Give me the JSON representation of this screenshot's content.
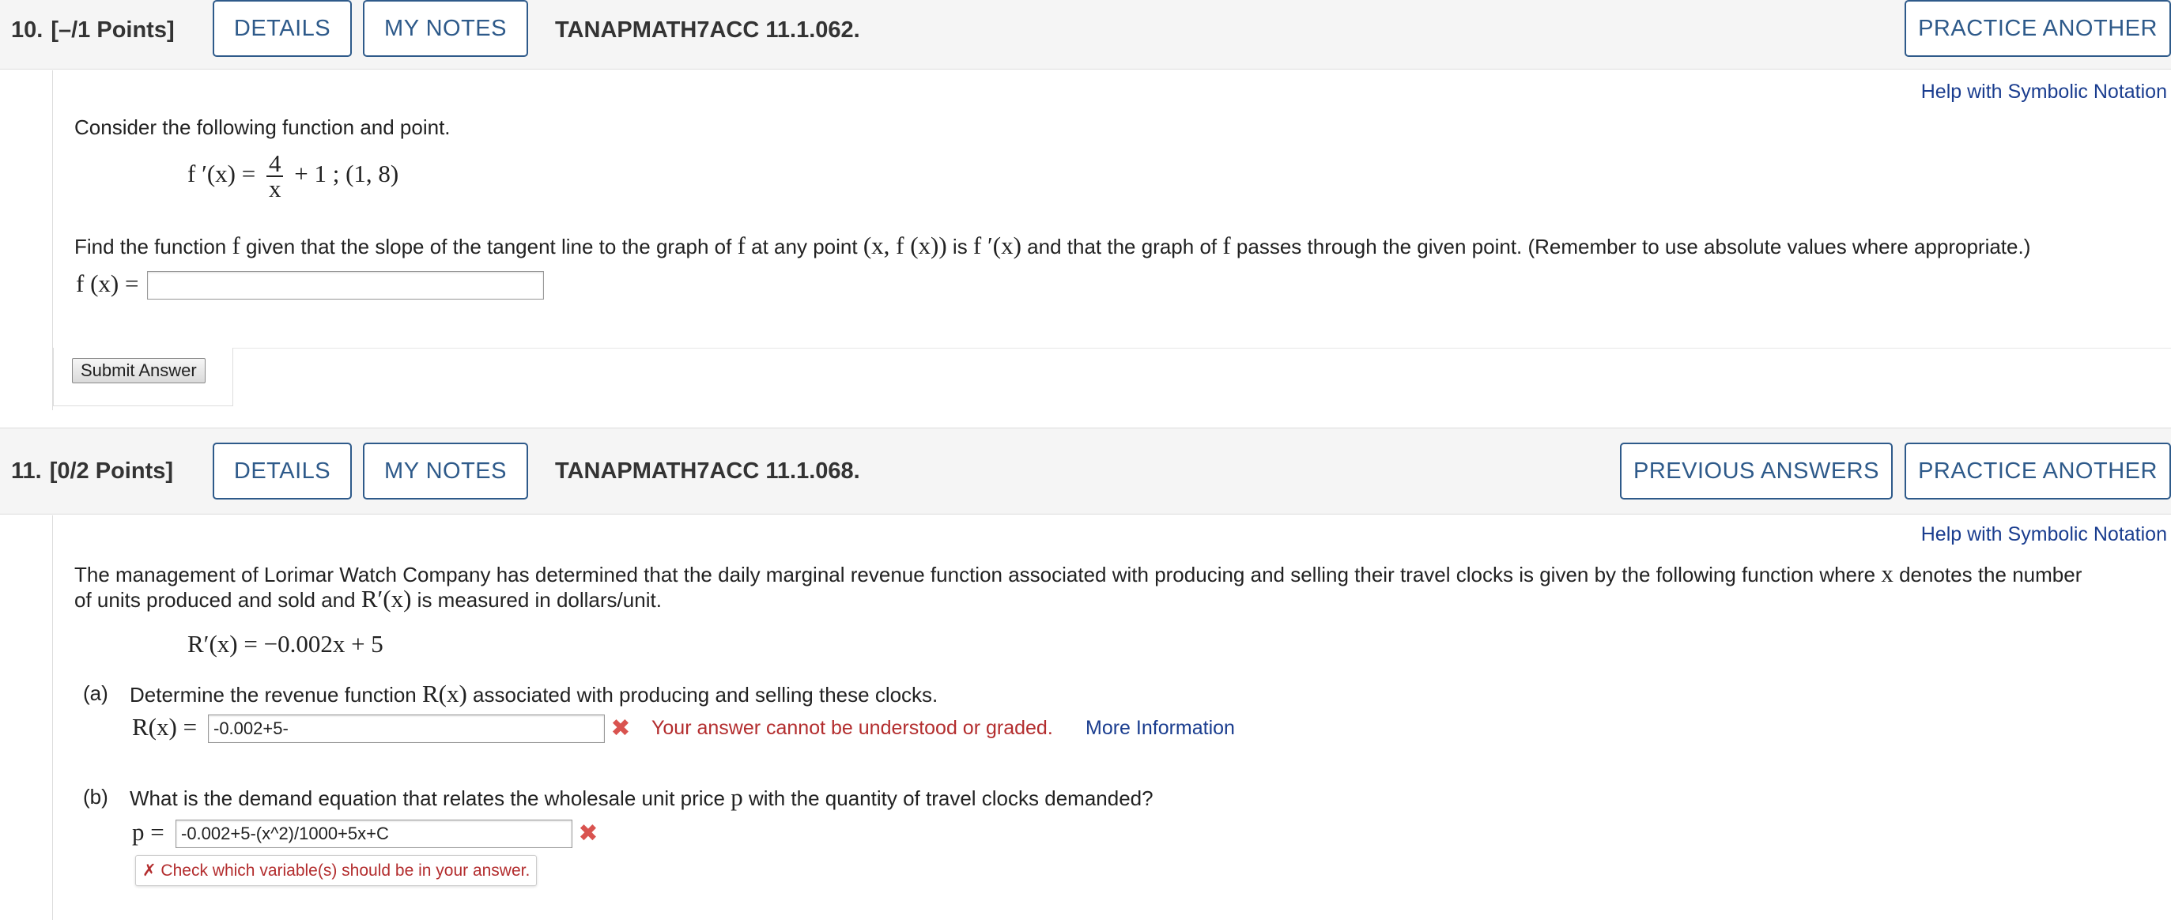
{
  "q10": {
    "number": "10.",
    "points": "[–/1 Points]",
    "details_label": "DETAILS",
    "notes_label": "MY NOTES",
    "code": "TANAPMATH7ACC 11.1.062.",
    "practice_label": "PRACTICE ANOTHER",
    "help_link": "Help with Symbolic Notation",
    "intro": "Consider the following function and point.",
    "formula": {
      "lhs": "f ′(x) =",
      "numerator": "4",
      "denominator": "x",
      "rest": "+ 1 ;  (1, 8)"
    },
    "prompt": {
      "p1": "Find the function ",
      "f1": "f",
      "p2": " given that the slope of the tangent line to the graph of ",
      "f2": "f",
      "p3": " at any point ",
      "pt": "(x, f (x))",
      "p4": " is ",
      "fp": "f ′(x)",
      "p5": " and that the graph of ",
      "f3": "f",
      "p6": " passes through the given point. (Remember to use absolute values where appropriate.)"
    },
    "answer_label": "f (x) =",
    "answer_value": "",
    "submit_label": "Submit Answer"
  },
  "q11": {
    "number": "11.",
    "points": "[0/2 Points]",
    "details_label": "DETAILS",
    "notes_label": "MY NOTES",
    "code": "TANAPMATH7ACC 11.1.068.",
    "previous_label": "PREVIOUS ANSWERS",
    "practice_label": "PRACTICE ANOTHER",
    "help_link": "Help with Symbolic Notation",
    "intro": {
      "line1_a": "The management of Lorimar Watch Company has determined that the daily marginal revenue function associated with producing and selling their travel clocks is given by the following function where ",
      "x": "x",
      "line1_b": " denotes the number",
      "line2_a": "of units produced and sold and ",
      "rp": "R′(x)",
      "line2_b": " is measured in dollars/unit."
    },
    "formula": "R′(x) = −0.002x + 5",
    "part_a": {
      "label": "(a)",
      "q1": "Determine the revenue function ",
      "rx": "R(x)",
      "q2": " associated with producing and selling these clocks.",
      "answer_label": "R(x) =",
      "answer_value": "-0.002+5-",
      "error": "Your answer cannot be understood or graded.",
      "more_info": "More Information"
    },
    "part_b": {
      "label": "(b)",
      "q1": "What is the demand equation that relates the wholesale unit price ",
      "p": "p",
      "q2": " with the quantity of travel clocks demanded?",
      "answer_label": "p =",
      "answer_value": "-0.002+5-(x^2)/1000+5x+C",
      "hint": "✗ Check which variable(s) should be in your answer."
    }
  },
  "colors": {
    "button_border": "#2e5a8a",
    "link": "#1a3d8f",
    "error": "#b32d2e",
    "x_mark": "#d9534f"
  }
}
